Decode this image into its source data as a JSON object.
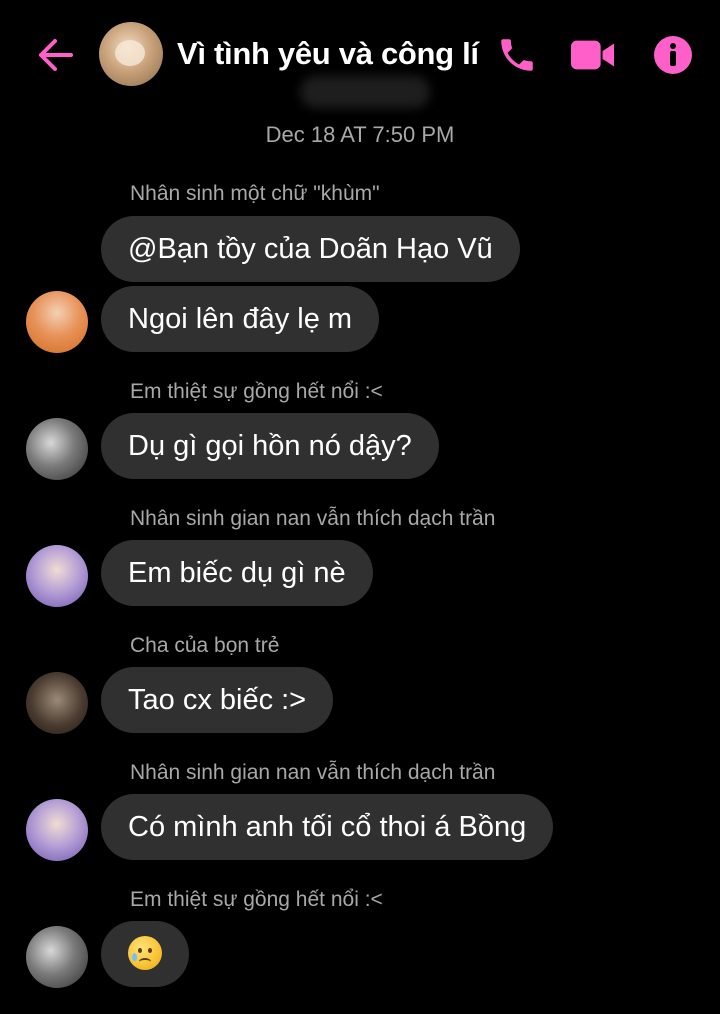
{
  "header": {
    "title": "Vì tình yêu và công lí",
    "icons": [
      "back-arrow-icon",
      "phone-icon",
      "video-camera-icon",
      "info-icon"
    ],
    "accent_color": "#ff5fc8"
  },
  "timestamp": "Dec 18 AT 7:50 PM",
  "messages": [
    {
      "sender": "Nhân sinh một chữ \"khùm\"",
      "bubbles": [
        "@Bạn tồy của Doãn Hạo Vũ",
        "Ngoi lên đây lẹ m"
      ]
    },
    {
      "sender": "Em thiệt sự gồng hết nổi :<",
      "bubbles": [
        "Dụ gì gọi hồn nó dậy?"
      ]
    },
    {
      "sender": "Nhân sinh gian nan vẫn thích dạch trần",
      "bubbles": [
        "Em biếc dụ gì nè"
      ]
    },
    {
      "sender": "Cha của bọn trẻ",
      "bubbles": [
        "Tao cx biếc :>"
      ]
    },
    {
      "sender": "Nhân sinh gian nan vẫn thích dạch trần",
      "bubbles": [
        "Có mình anh tối cổ thoi á Bồng"
      ]
    },
    {
      "sender": "Em thiệt sự gồng hết nổi :<",
      "bubbles": [
        "sad-tear-emoji"
      ]
    }
  ],
  "colors": {
    "background": "#000000",
    "bubble": "#303030",
    "meta_text": "#a8a8a8"
  }
}
